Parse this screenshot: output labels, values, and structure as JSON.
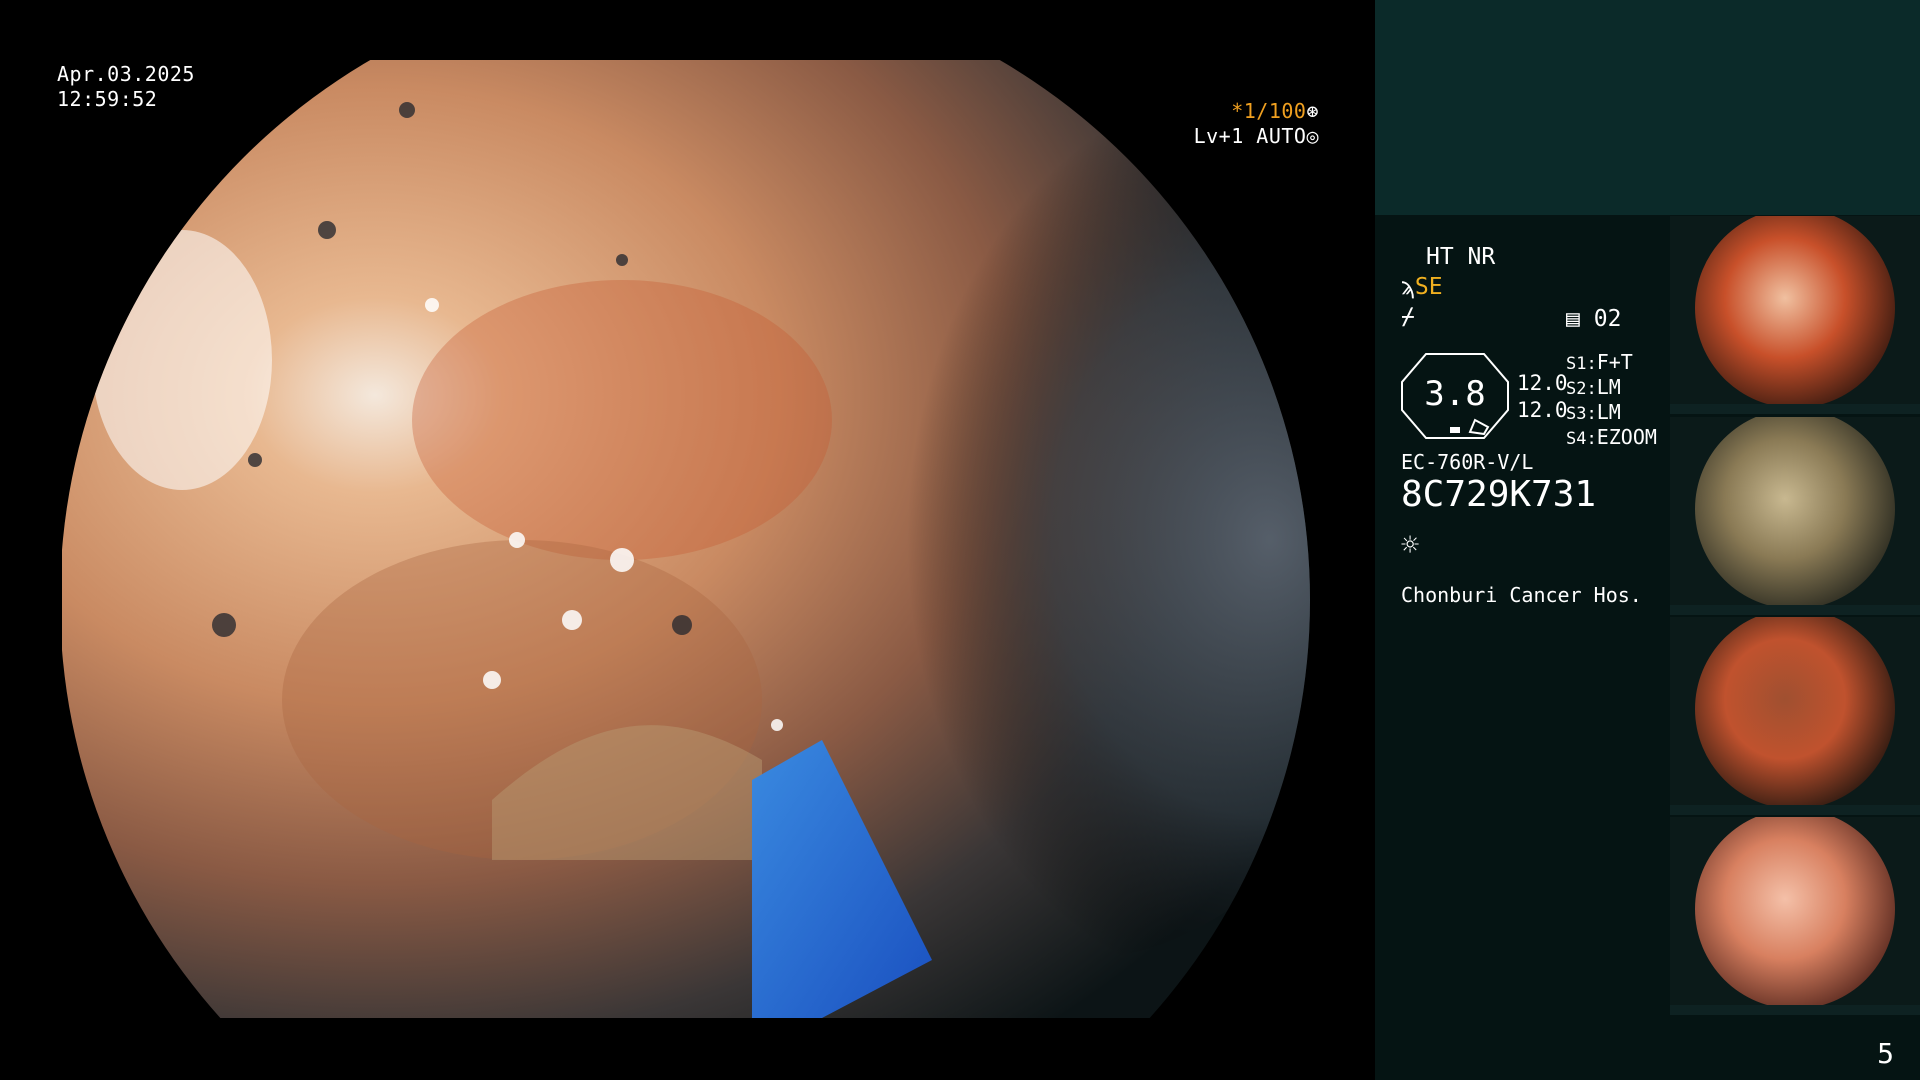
{
  "osd": {
    "date": "Apr.03.2025",
    "time": "12:59:52",
    "shutter_speed": "*1/100",
    "iris_mode": "Lv+1 AUTO"
  },
  "side_panel": {
    "enhancement": "HT NR",
    "structure_mode": "SE",
    "preset_number": "02",
    "zoom_value": "3.8",
    "zoom_sub1": "12.0",
    "zoom_sub2": "12.0",
    "switches": [
      {
        "key": "S1:",
        "value": "F+T"
      },
      {
        "key": "S2:",
        "value": "LM"
      },
      {
        "key": "S3:",
        "value": "LM"
      },
      {
        "key": "S4:",
        "value": "EZOOM"
      }
    ],
    "scope_model": "EC-760R-V/L",
    "serial_number": "8C729K731",
    "hospital": "Chonburi Cancer Hos."
  },
  "thumbnails": [
    {
      "label": "thumbnail-1",
      "tone": "#c8502a"
    },
    {
      "label": "thumbnail-2",
      "tone": "#8a7a55"
    },
    {
      "label": "thumbnail-3",
      "tone": "#c0522e"
    },
    {
      "label": "thumbnail-4",
      "tone": "#d88060"
    }
  ],
  "page_number": "5"
}
